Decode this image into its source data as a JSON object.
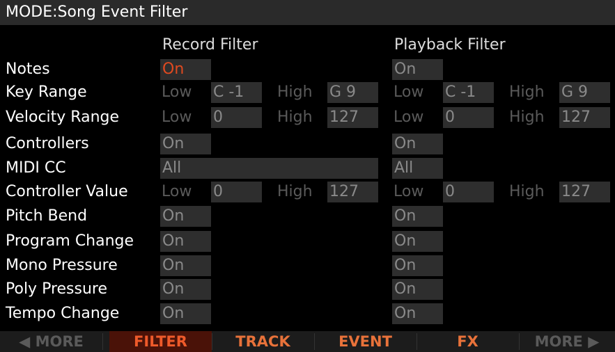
{
  "title": "MODE:Song Event Filter",
  "headers": {
    "record": "Record Filter",
    "playback": "Playback Filter"
  },
  "words": {
    "low": "Low",
    "high": "High"
  },
  "accent_color": "#e04a20",
  "rows": {
    "notes": {
      "label": "Notes",
      "rec": "On",
      "play": "On"
    },
    "key_range": {
      "label": "Key Range",
      "rec_low": "C -1",
      "rec_high": "G 9",
      "play_low": "C -1",
      "play_high": "G 9"
    },
    "velocity_range": {
      "label": "Velocity Range",
      "rec_low": "0",
      "rec_high": "127",
      "play_low": "0",
      "play_high": "127"
    },
    "controllers": {
      "label": "Controllers",
      "rec": "On",
      "play": "On"
    },
    "midi_cc": {
      "label": "MIDI CC",
      "rec": "All",
      "play": "All"
    },
    "controller_value": {
      "label": "Controller Value",
      "rec_low": "0",
      "rec_high": "127",
      "play_low": "0",
      "play_high": "127"
    },
    "pitch_bend": {
      "label": "Pitch Bend",
      "rec": "On",
      "play": "On"
    },
    "program_change": {
      "label": "Program Change",
      "rec": "On",
      "play": "On"
    },
    "mono_pressure": {
      "label": "Mono Pressure",
      "rec": "On",
      "play": "On"
    },
    "poly_pressure": {
      "label": "Poly Pressure",
      "rec": "On",
      "play": "On"
    },
    "tempo_change": {
      "label": "Tempo Change",
      "rec": "On",
      "play": "On"
    }
  },
  "softkeys": {
    "more_left": "◀ MORE",
    "filter": "FILTER",
    "track": "TRACK",
    "event": "EVENT",
    "fx": "FX",
    "more_right": "MORE ▶"
  }
}
